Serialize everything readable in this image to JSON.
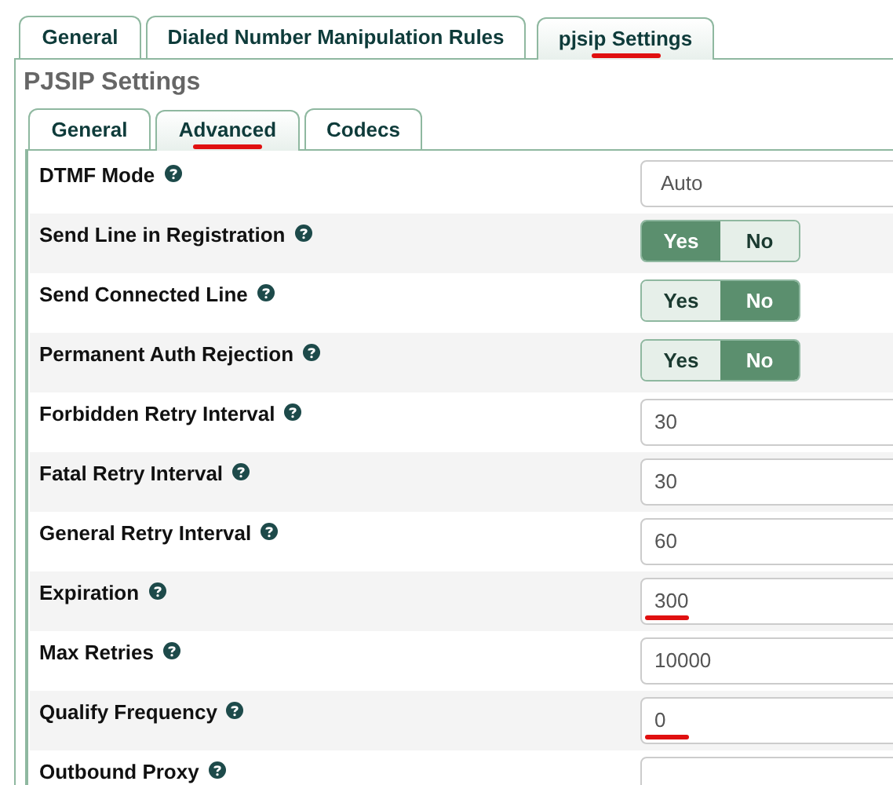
{
  "outer_tabs": [
    {
      "label": "General",
      "selected": false,
      "annotated": false
    },
    {
      "label": "Dialed Number Manipulation Rules",
      "selected": false,
      "annotated": false
    },
    {
      "label": "pjsip Settings",
      "selected": true,
      "annotated": true
    }
  ],
  "panel": {
    "title": "PJSIP Settings",
    "tabs": [
      {
        "label": "General",
        "selected": false,
        "annotated": false
      },
      {
        "label": "Advanced",
        "selected": true,
        "annotated": true
      },
      {
        "label": "Codecs",
        "selected": false,
        "annotated": false
      }
    ],
    "fields": [
      {
        "kind": "select",
        "label": "DTMF Mode",
        "value": "Auto",
        "annotated": false
      },
      {
        "kind": "toggle",
        "label": "Send Line in Registration",
        "options": [
          {
            "label": "Yes",
            "selected": true
          },
          {
            "label": "No",
            "selected": false
          }
        ]
      },
      {
        "kind": "toggle",
        "label": "Send Connected Line",
        "options": [
          {
            "label": "Yes",
            "selected": false
          },
          {
            "label": "No",
            "selected": true
          }
        ]
      },
      {
        "kind": "toggle",
        "label": "Permanent Auth Rejection",
        "options": [
          {
            "label": "Yes",
            "selected": false
          },
          {
            "label": "No",
            "selected": true
          }
        ]
      },
      {
        "kind": "input",
        "label": "Forbidden Retry Interval",
        "value": "30",
        "annotated": false
      },
      {
        "kind": "input",
        "label": "Fatal Retry Interval",
        "value": "30",
        "annotated": false
      },
      {
        "kind": "input",
        "label": "General Retry Interval",
        "value": "60",
        "annotated": false
      },
      {
        "kind": "input",
        "label": "Expiration",
        "value": "300",
        "annotated": true
      },
      {
        "kind": "input",
        "label": "Max Retries",
        "value": "10000",
        "annotated": false
      },
      {
        "kind": "input",
        "label": "Qualify Frequency",
        "value": "0",
        "annotated": true
      },
      {
        "kind": "input",
        "label": "Outbound Proxy"
      }
    ]
  }
}
